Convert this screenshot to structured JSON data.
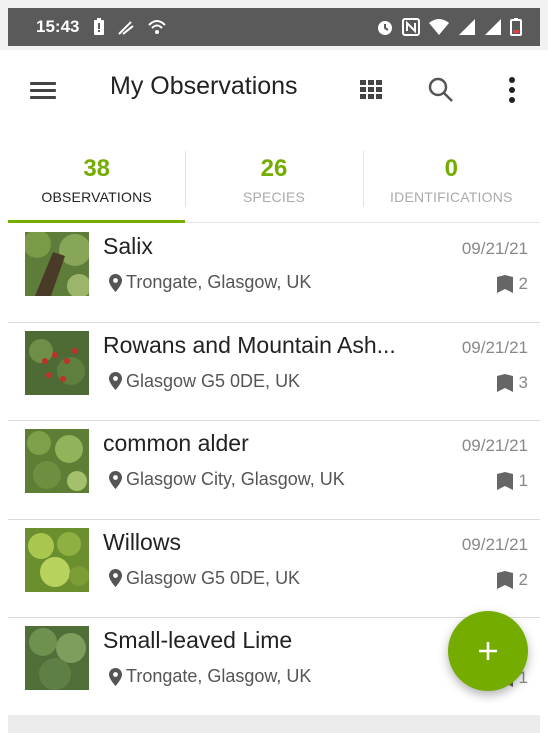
{
  "status_bar": {
    "time": "15:43",
    "icons": [
      "battery-alert-icon",
      "signal-off-icon",
      "wifi-icon",
      "alarm-icon",
      "nfc-icon",
      "wifi-full-icon",
      "cell-signal-icon",
      "cell-signal-icon",
      "battery-icon"
    ]
  },
  "toolbar": {
    "title": "My Observations",
    "menu_icon": "hamburger-menu-icon",
    "grid_icon": "grid-view-icon",
    "search_icon": "search-icon",
    "more_icon": "more-vert-icon"
  },
  "tabs": [
    {
      "count": "38",
      "label": "OBSERVATIONS",
      "active": true
    },
    {
      "count": "26",
      "label": "SPECIES",
      "active": false
    },
    {
      "count": "0",
      "label": "IDENTIFICATIONS",
      "active": false
    }
  ],
  "observations": [
    {
      "name": "Salix",
      "location": "Trongate, Glasgow, UK",
      "date": "09/21/21",
      "ids": "2"
    },
    {
      "name": "Rowans and Mountain Ash...",
      "location": "Glasgow G5 0DE, UK",
      "date": "09/21/21",
      "ids": "3"
    },
    {
      "name": "common alder",
      "location": "Glasgow City, Glasgow, UK",
      "date": "09/21/21",
      "ids": "1"
    },
    {
      "name": "Willows",
      "location": "Glasgow G5 0DE, UK",
      "date": "09/21/21",
      "ids": "2"
    },
    {
      "name": "Small-leaved Lime",
      "location": "Trongate, Glasgow, UK",
      "date": "",
      "ids": "1"
    }
  ],
  "fab": {
    "label": "+",
    "icon": "add-icon"
  },
  "colors": {
    "accent": "#74ac00",
    "status_bar": "#5a5a5a"
  }
}
